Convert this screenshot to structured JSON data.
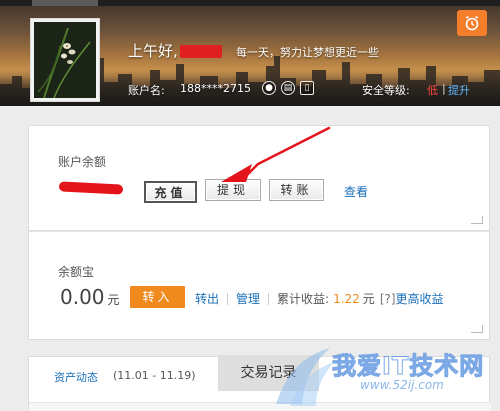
{
  "header": {
    "greeting": "上午好,",
    "motto": "每一天，努力让梦想更近一些",
    "account_label": "账户名:",
    "account_number": "188****2715",
    "security_label": "安全等级:",
    "security_level": "低",
    "upgrade_link": "提升",
    "alarm_icon": "alarm-clock-icon",
    "security_icons": [
      "user-verify-icon",
      "id-card-icon",
      "phone-icon"
    ]
  },
  "balance_panel": {
    "label": "账户余额",
    "recharge_button": "充值",
    "withdraw_button": "提现",
    "transfer_button": "转账",
    "view_link": "查看"
  },
  "yuebao_panel": {
    "label": "余额宝",
    "amount": "0.00",
    "unit": "元",
    "transfer_in_button": "转入",
    "transfer_out_link": "转出",
    "manage_link": "管理",
    "earnings_label": "累计收益:",
    "earnings_value": "1.22",
    "earnings_unit": "元",
    "help_icon": "[?]",
    "more_earnings_link": "更高收益"
  },
  "activity_panel": {
    "label": "资产动态",
    "date_range": "(11.01 - 11.19)",
    "trade_tab": "交易记录"
  },
  "watermark": {
    "text": "我爱IT技术网",
    "subtext": "www.52ij.com"
  },
  "colors": {
    "accent_orange": "#f08a1f",
    "link_blue": "#1a6fb8",
    "annotation_red": "#e4141b"
  }
}
